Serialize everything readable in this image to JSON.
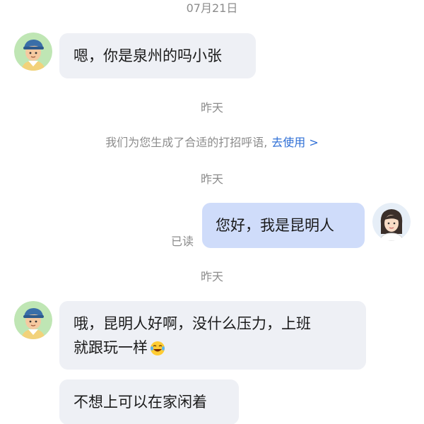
{
  "timestamps": {
    "t1": "07月21日",
    "t2": "昨天",
    "t3": "昨天",
    "t4": "昨天"
  },
  "system_tip": {
    "text": "我们为您生成了合适的打招呼语,",
    "link": "去使用 >"
  },
  "messages": [
    {
      "side": "in",
      "text": "嗯，你是泉州的吗小张"
    },
    {
      "side": "out",
      "text": "您好，我是昆明人",
      "status": "已读"
    },
    {
      "side": "in",
      "line1": "哦，昆明人好啊，没什么压力，上班",
      "line2": "就跟玩一样",
      "emoji": "laughing-tears-emoji"
    },
    {
      "side": "in",
      "text": "不想上可以在家闲着"
    }
  ],
  "colors": {
    "incoming_bubble": "#eef0f5",
    "outgoing_bubble": "#cfdcfa",
    "link": "#2f6fd6",
    "muted_text": "#8c8c8c"
  }
}
